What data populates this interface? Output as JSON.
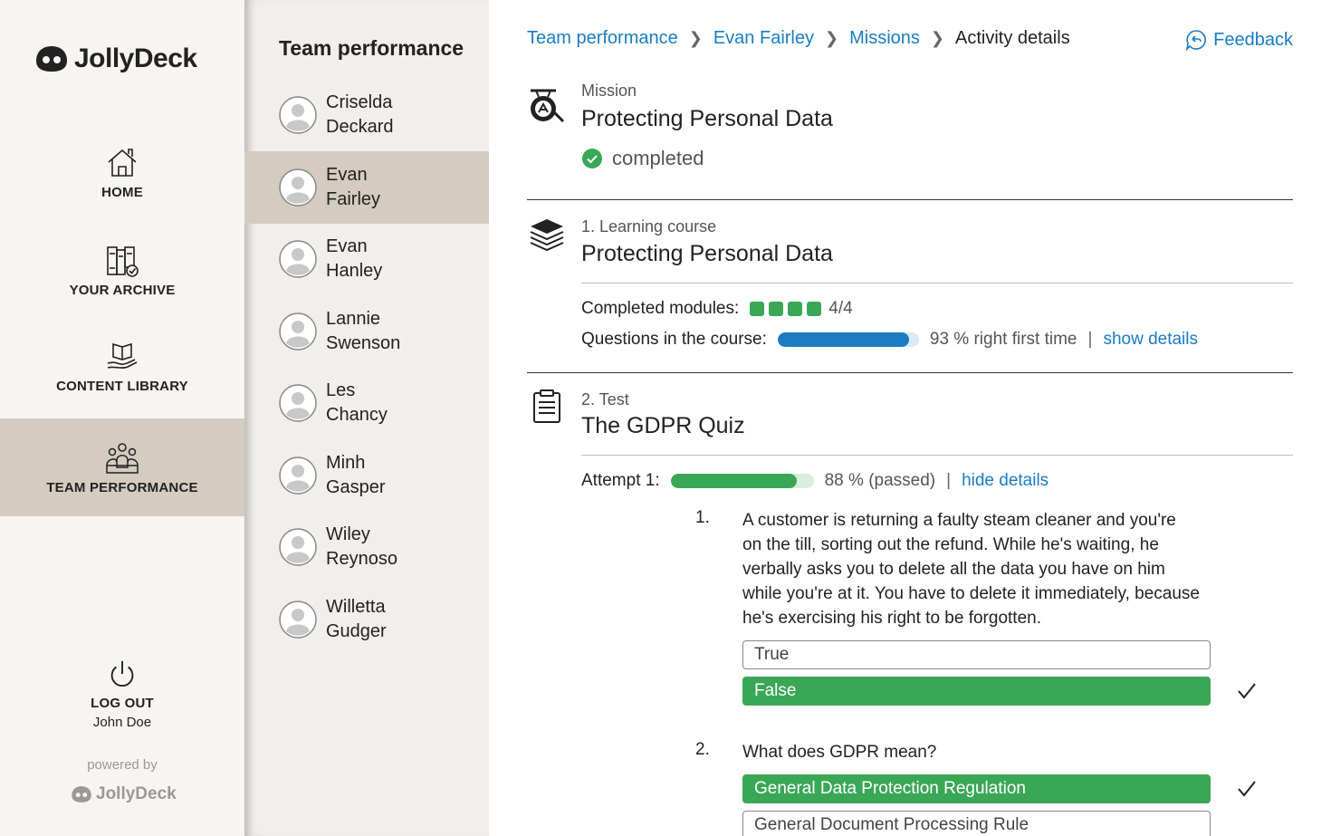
{
  "app": {
    "logo_text": "JollyDeck",
    "accent_color": "#1b7cc1",
    "success_color": "#3aa757",
    "selected_bg": "#d4ccc0"
  },
  "nav": {
    "home": "HOME",
    "archive": "YOUR ARCHIVE",
    "library": "CONTENT LIBRARY",
    "team": "TEAM PERFORMANCE",
    "logout": "LOG OUT",
    "user": "John Doe",
    "powered_by": "powered by",
    "powered_logo": "JollyDeck"
  },
  "members_panel": {
    "title": "Team performance",
    "members": [
      {
        "first": "Criselda",
        "last": "Deckard"
      },
      {
        "first": "Evan",
        "last": "Fairley"
      },
      {
        "first": "Evan",
        "last": "Hanley"
      },
      {
        "first": "Lannie",
        "last": "Swenson"
      },
      {
        "first": "Les",
        "last": "Chancy"
      },
      {
        "first": "Minh",
        "last": "Gasper"
      },
      {
        "first": "Wiley",
        "last": "Reynoso"
      },
      {
        "first": "Willetta",
        "last": "Gudger"
      }
    ],
    "selected_index": 1
  },
  "breadcrumb": {
    "items": [
      "Team performance",
      "Evan Fairley",
      "Missions"
    ],
    "current": "Activity details"
  },
  "feedback": {
    "label": "Feedback"
  },
  "mission": {
    "kind": "Mission",
    "title": "Protecting Personal Data",
    "status": "completed"
  },
  "course": {
    "kind": "1. Learning course",
    "title": "Protecting Personal Data",
    "modules_label": "Completed modules:",
    "modules_done": 4,
    "modules_total": 4,
    "modules_count": "4/4",
    "questions_label": "Questions in the course:",
    "right_first_time_percent": 93,
    "questions_result": "93 % right first time",
    "details_link": "show details"
  },
  "test": {
    "kind": "2. Test",
    "title": "The GDPR Quiz",
    "attempt_label": "Attempt 1:",
    "score_percent": 88,
    "attempt_result": "88 % (passed)",
    "details_link": "hide details",
    "questions": [
      {
        "number": "1.",
        "text": "A customer is returning a faulty steam cleaner and you're on the till, sorting out the refund. While he's waiting, he verbally asks you to delete all the data you have on him while you're at it. You have to delete it immediately, because he's exercising his right to be forgotten.",
        "answers": [
          {
            "label": "True",
            "correct": false
          },
          {
            "label": "False",
            "correct": true
          }
        ]
      },
      {
        "number": "2.",
        "text": "What does GDPR mean?",
        "answers": [
          {
            "label": "General Data Protection Regulation",
            "correct": true
          },
          {
            "label": "General Document Processing Rule",
            "correct": false
          }
        ]
      }
    ]
  },
  "icons": {
    "home": "home-icon",
    "archive": "archive-icon",
    "library": "book-hand-icon",
    "team": "team-icon",
    "logout": "power-icon",
    "feedback": "feedback-icon",
    "mission": "gong-icon",
    "course": "stack-icon",
    "test": "clipboard-icon",
    "avatar": "avatar-icon",
    "status": "check-circle-icon",
    "answer_check": "checkmark-icon"
  }
}
